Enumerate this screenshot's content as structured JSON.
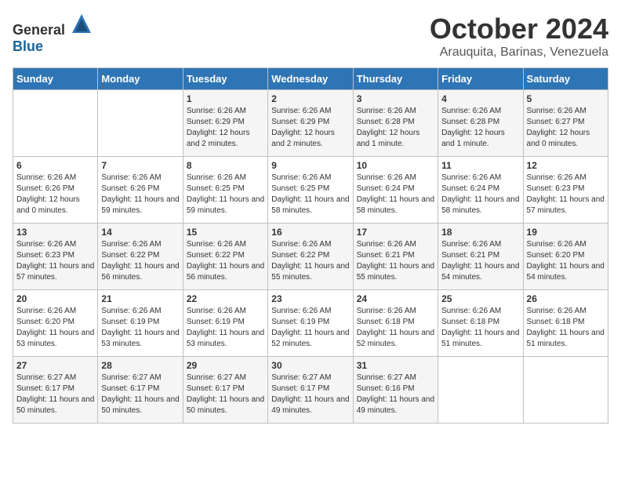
{
  "header": {
    "logo_general": "General",
    "logo_blue": "Blue",
    "month_title": "October 2024",
    "location": "Arauquita, Barinas, Venezuela"
  },
  "days_of_week": [
    "Sunday",
    "Monday",
    "Tuesday",
    "Wednesday",
    "Thursday",
    "Friday",
    "Saturday"
  ],
  "weeks": [
    [
      {
        "day": "",
        "sunrise": "",
        "sunset": "",
        "daylight": ""
      },
      {
        "day": "",
        "sunrise": "",
        "sunset": "",
        "daylight": ""
      },
      {
        "day": "1",
        "sunrise": "Sunrise: 6:26 AM",
        "sunset": "Sunset: 6:29 PM",
        "daylight": "Daylight: 12 hours and 2 minutes."
      },
      {
        "day": "2",
        "sunrise": "Sunrise: 6:26 AM",
        "sunset": "Sunset: 6:29 PM",
        "daylight": "Daylight: 12 hours and 2 minutes."
      },
      {
        "day": "3",
        "sunrise": "Sunrise: 6:26 AM",
        "sunset": "Sunset: 6:28 PM",
        "daylight": "Daylight: 12 hours and 1 minute."
      },
      {
        "day": "4",
        "sunrise": "Sunrise: 6:26 AM",
        "sunset": "Sunset: 6:28 PM",
        "daylight": "Daylight: 12 hours and 1 minute."
      },
      {
        "day": "5",
        "sunrise": "Sunrise: 6:26 AM",
        "sunset": "Sunset: 6:27 PM",
        "daylight": "Daylight: 12 hours and 0 minutes."
      }
    ],
    [
      {
        "day": "6",
        "sunrise": "Sunrise: 6:26 AM",
        "sunset": "Sunset: 6:26 PM",
        "daylight": "Daylight: 12 hours and 0 minutes."
      },
      {
        "day": "7",
        "sunrise": "Sunrise: 6:26 AM",
        "sunset": "Sunset: 6:26 PM",
        "daylight": "Daylight: 11 hours and 59 minutes."
      },
      {
        "day": "8",
        "sunrise": "Sunrise: 6:26 AM",
        "sunset": "Sunset: 6:25 PM",
        "daylight": "Daylight: 11 hours and 59 minutes."
      },
      {
        "day": "9",
        "sunrise": "Sunrise: 6:26 AM",
        "sunset": "Sunset: 6:25 PM",
        "daylight": "Daylight: 11 hours and 58 minutes."
      },
      {
        "day": "10",
        "sunrise": "Sunrise: 6:26 AM",
        "sunset": "Sunset: 6:24 PM",
        "daylight": "Daylight: 11 hours and 58 minutes."
      },
      {
        "day": "11",
        "sunrise": "Sunrise: 6:26 AM",
        "sunset": "Sunset: 6:24 PM",
        "daylight": "Daylight: 11 hours and 58 minutes."
      },
      {
        "day": "12",
        "sunrise": "Sunrise: 6:26 AM",
        "sunset": "Sunset: 6:23 PM",
        "daylight": "Daylight: 11 hours and 57 minutes."
      }
    ],
    [
      {
        "day": "13",
        "sunrise": "Sunrise: 6:26 AM",
        "sunset": "Sunset: 6:23 PM",
        "daylight": "Daylight: 11 hours and 57 minutes."
      },
      {
        "day": "14",
        "sunrise": "Sunrise: 6:26 AM",
        "sunset": "Sunset: 6:22 PM",
        "daylight": "Daylight: 11 hours and 56 minutes."
      },
      {
        "day": "15",
        "sunrise": "Sunrise: 6:26 AM",
        "sunset": "Sunset: 6:22 PM",
        "daylight": "Daylight: 11 hours and 56 minutes."
      },
      {
        "day": "16",
        "sunrise": "Sunrise: 6:26 AM",
        "sunset": "Sunset: 6:22 PM",
        "daylight": "Daylight: 11 hours and 55 minutes."
      },
      {
        "day": "17",
        "sunrise": "Sunrise: 6:26 AM",
        "sunset": "Sunset: 6:21 PM",
        "daylight": "Daylight: 11 hours and 55 minutes."
      },
      {
        "day": "18",
        "sunrise": "Sunrise: 6:26 AM",
        "sunset": "Sunset: 6:21 PM",
        "daylight": "Daylight: 11 hours and 54 minutes."
      },
      {
        "day": "19",
        "sunrise": "Sunrise: 6:26 AM",
        "sunset": "Sunset: 6:20 PM",
        "daylight": "Daylight: 11 hours and 54 minutes."
      }
    ],
    [
      {
        "day": "20",
        "sunrise": "Sunrise: 6:26 AM",
        "sunset": "Sunset: 6:20 PM",
        "daylight": "Daylight: 11 hours and 53 minutes."
      },
      {
        "day": "21",
        "sunrise": "Sunrise: 6:26 AM",
        "sunset": "Sunset: 6:19 PM",
        "daylight": "Daylight: 11 hours and 53 minutes."
      },
      {
        "day": "22",
        "sunrise": "Sunrise: 6:26 AM",
        "sunset": "Sunset: 6:19 PM",
        "daylight": "Daylight: 11 hours and 53 minutes."
      },
      {
        "day": "23",
        "sunrise": "Sunrise: 6:26 AM",
        "sunset": "Sunset: 6:19 PM",
        "daylight": "Daylight: 11 hours and 52 minutes."
      },
      {
        "day": "24",
        "sunrise": "Sunrise: 6:26 AM",
        "sunset": "Sunset: 6:18 PM",
        "daylight": "Daylight: 11 hours and 52 minutes."
      },
      {
        "day": "25",
        "sunrise": "Sunrise: 6:26 AM",
        "sunset": "Sunset: 6:18 PM",
        "daylight": "Daylight: 11 hours and 51 minutes."
      },
      {
        "day": "26",
        "sunrise": "Sunrise: 6:26 AM",
        "sunset": "Sunset: 6:18 PM",
        "daylight": "Daylight: 11 hours and 51 minutes."
      }
    ],
    [
      {
        "day": "27",
        "sunrise": "Sunrise: 6:27 AM",
        "sunset": "Sunset: 6:17 PM",
        "daylight": "Daylight: 11 hours and 50 minutes."
      },
      {
        "day": "28",
        "sunrise": "Sunrise: 6:27 AM",
        "sunset": "Sunset: 6:17 PM",
        "daylight": "Daylight: 11 hours and 50 minutes."
      },
      {
        "day": "29",
        "sunrise": "Sunrise: 6:27 AM",
        "sunset": "Sunset: 6:17 PM",
        "daylight": "Daylight: 11 hours and 50 minutes."
      },
      {
        "day": "30",
        "sunrise": "Sunrise: 6:27 AM",
        "sunset": "Sunset: 6:17 PM",
        "daylight": "Daylight: 11 hours and 49 minutes."
      },
      {
        "day": "31",
        "sunrise": "Sunrise: 6:27 AM",
        "sunset": "Sunset: 6:16 PM",
        "daylight": "Daylight: 11 hours and 49 minutes."
      },
      {
        "day": "",
        "sunrise": "",
        "sunset": "",
        "daylight": ""
      },
      {
        "day": "",
        "sunrise": "",
        "sunset": "",
        "daylight": ""
      }
    ]
  ]
}
